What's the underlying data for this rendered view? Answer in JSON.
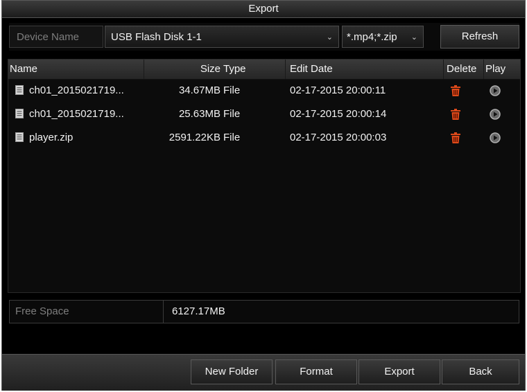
{
  "window": {
    "title": "Export"
  },
  "device": {
    "label": "Device Name",
    "selected": "USB Flash Disk 1-1",
    "filter": "*.mp4;*.zip",
    "refresh_label": "Refresh"
  },
  "table": {
    "columns": {
      "name": "Name",
      "size": "Size",
      "type": "Type",
      "date": "Edit Date",
      "delete": "Delete",
      "play": "Play"
    },
    "rows": [
      {
        "name": "ch01_2015021719...",
        "size": "34.67MB",
        "type": "File",
        "date": "02-17-2015 20:00:11"
      },
      {
        "name": "ch01_2015021719...",
        "size": "25.63MB",
        "type": "File",
        "date": "02-17-2015 20:00:14"
      },
      {
        "name": "player.zip",
        "size": "2591.22KB",
        "type": "File",
        "date": "02-17-2015 20:00:03"
      }
    ]
  },
  "free_space": {
    "label": "Free Space",
    "value": "6127.17MB"
  },
  "buttons": {
    "new_folder": "New Folder",
    "format": "Format",
    "export": "Export",
    "back": "Back"
  },
  "icons": {
    "file": "file-icon",
    "delete": "trash-icon",
    "play": "play-icon",
    "dropdown": "chevron-down-icon"
  },
  "colors": {
    "delete_icon": "#e04a1a",
    "play_icon": "#9a9a9a",
    "label_dim": "#7e7e7e"
  }
}
